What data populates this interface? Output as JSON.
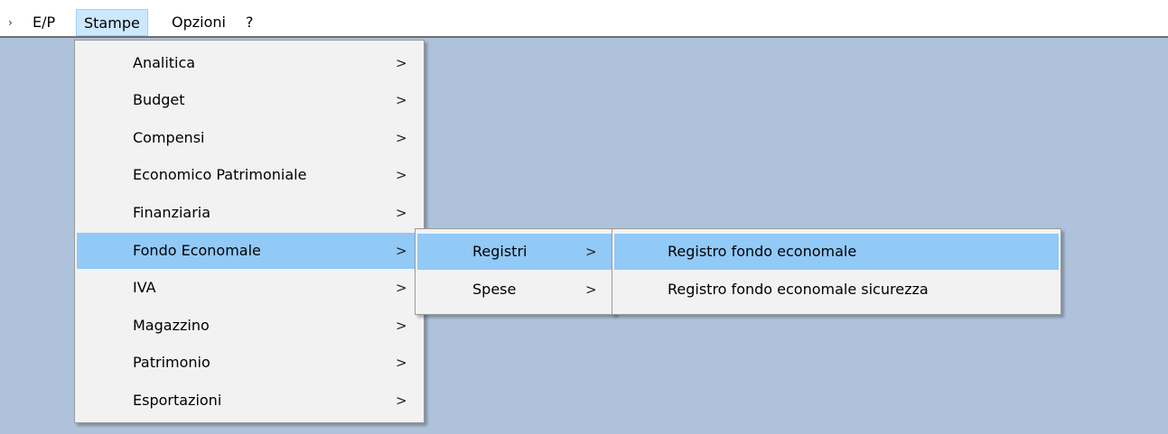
{
  "menubar": {
    "partial_glyph": "›",
    "items": [
      {
        "label": "E/P"
      },
      {
        "label": "Stampe"
      },
      {
        "label": "Opzioni"
      },
      {
        "label": "?"
      }
    ]
  },
  "stampe_menu": {
    "items": [
      {
        "label": "Analitica",
        "arrow": ">"
      },
      {
        "label": "Budget",
        "arrow": ">"
      },
      {
        "label": "Compensi",
        "arrow": ">"
      },
      {
        "label": "Economico Patrimoniale",
        "arrow": ">"
      },
      {
        "label": "Finanziaria",
        "arrow": ">"
      },
      {
        "label": "Fondo Economale",
        "arrow": ">"
      },
      {
        "label": "IVA",
        "arrow": ">"
      },
      {
        "label": "Magazzino",
        "arrow": ">"
      },
      {
        "label": "Patrimonio",
        "arrow": ">"
      },
      {
        "label": "Esportazioni",
        "arrow": ">"
      }
    ]
  },
  "fondo_economale_menu": {
    "items": [
      {
        "label": "Registri",
        "arrow": ">"
      },
      {
        "label": "Spese",
        "arrow": ">"
      }
    ]
  },
  "registri_menu": {
    "items": [
      {
        "label": "Registro fondo economale"
      },
      {
        "label": "Registro fondo economale sicurezza"
      }
    ]
  },
  "colors": {
    "desktop": "#aec3db",
    "menu_background": "#f2f2f2",
    "highlight": "#91c9f7",
    "menubar_active": "#cce8ff"
  }
}
